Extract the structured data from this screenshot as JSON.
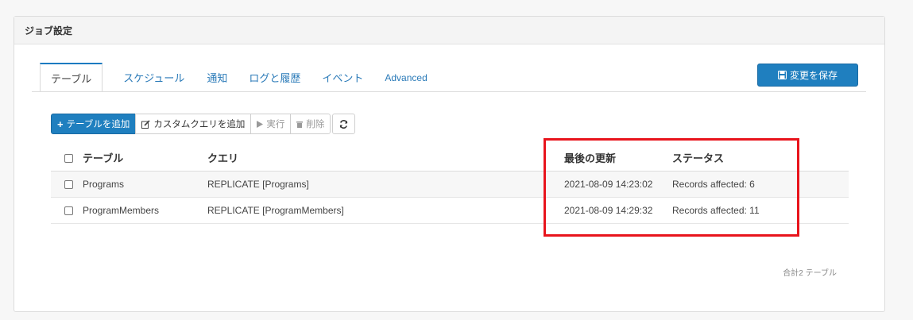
{
  "panel": {
    "title": "ジョブ設定"
  },
  "tabs": [
    {
      "label": "テーブル",
      "active": true
    },
    {
      "label": "スケジュール",
      "active": false
    },
    {
      "label": "通知",
      "active": false
    },
    {
      "label": "ログと履歴",
      "active": false
    },
    {
      "label": "イベント",
      "active": false
    },
    {
      "label": "Advanced",
      "active": false
    }
  ],
  "save_button": {
    "label": "変更を保存",
    "icon": "save-icon"
  },
  "toolbar": {
    "add_table": "テーブルを追加",
    "add_custom_query": "カスタムクエリを追加",
    "run": "実行",
    "delete": "削除"
  },
  "table": {
    "headers": {
      "table": "テーブル",
      "query": "クエリ",
      "last_updated": "最後の更新",
      "status": "ステータス"
    },
    "rows": [
      {
        "table": "Programs",
        "query": "REPLICATE [Programs]",
        "last_updated": "2021-08-09 14:23:02",
        "status": "Records affected: 6"
      },
      {
        "table": "ProgramMembers",
        "query": "REPLICATE [ProgramMembers]",
        "last_updated": "2021-08-09 14:29:32",
        "status": "Records affected: 11"
      }
    ]
  },
  "footer": {
    "count_text": "合計2 テーブル"
  },
  "colors": {
    "accent": "#1f7fbf",
    "highlight": "#e8141c"
  }
}
